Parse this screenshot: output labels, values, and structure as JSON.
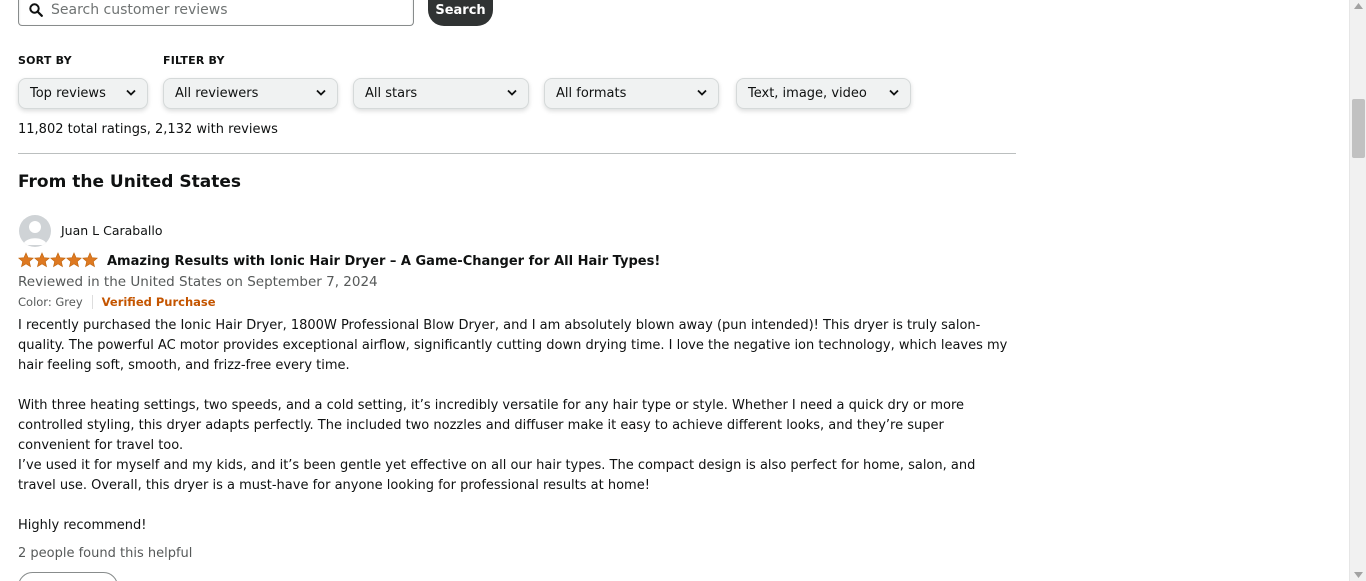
{
  "search": {
    "placeholder": "Search customer reviews",
    "button": "Search"
  },
  "sort": {
    "label": "SORT BY",
    "value": "Top reviews"
  },
  "filter": {
    "label": "FILTER BY",
    "reviewers": "All reviewers",
    "stars": "All stars",
    "formats": "All formats",
    "media": "Text, image, video"
  },
  "summary": "11,802 total ratings, 2,132 with reviews",
  "region_heading": "From the United States",
  "review": {
    "reviewer": "Juan L Caraballo",
    "rating": 5,
    "title": "Amazing Results with Ionic Hair Dryer – A Game-Changer for All Hair Types!",
    "date": "Reviewed in the United States on September 7, 2024",
    "color": "Color: Grey",
    "verified": "Verified Purchase",
    "paragraphs": [
      "I recently purchased the Ionic Hair Dryer, 1800W Professional Blow Dryer, and I am absolutely blown away (pun intended)! This dryer is truly salon-quality. The powerful AC motor provides exceptional airflow, significantly cutting down drying time. I love the negative ion technology, which leaves my hair feeling soft, smooth, and frizz-free every time.",
      "With three heating settings, two speeds, and a cold setting, it’s incredibly versatile for any hair type or style. Whether I need a quick dry or more controlled styling, this dryer adapts perfectly. The included two nozzles and diffuser make it easy to achieve different looks, and they’re super convenient for travel too.",
      "I’ve used it for myself and my kids, and it’s been gentle yet effective on all our hair types. The compact design is also perfect for home, salon, and travel use. Overall, this dryer is a must-have for anyone looking for professional results at home!",
      "Highly recommend!"
    ],
    "helpful": "2 people found this helpful"
  },
  "colors": {
    "star": "#de7921",
    "verified": "#c45500",
    "button_dark": "#303333"
  }
}
